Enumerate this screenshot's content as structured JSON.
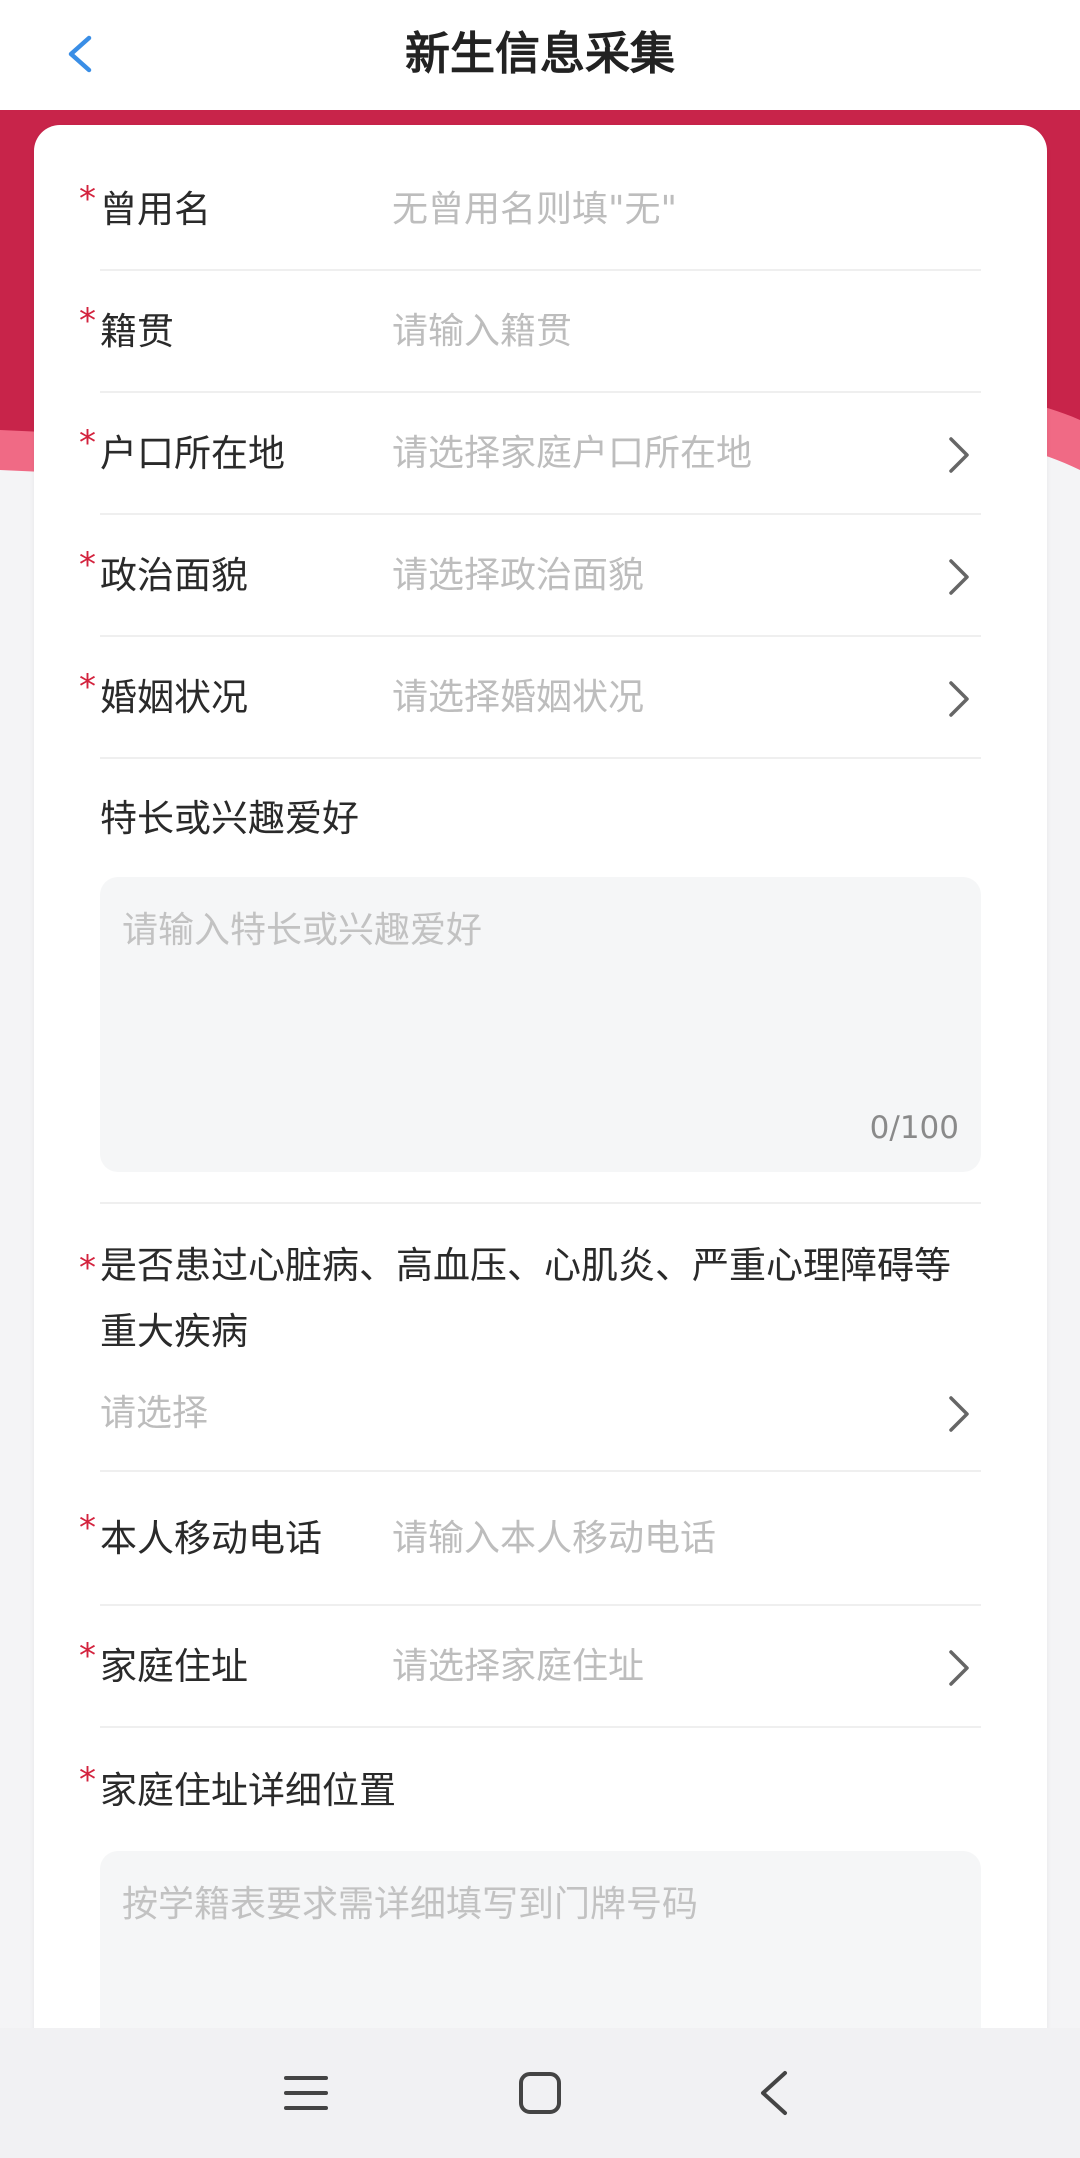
{
  "header": {
    "title": "新生信息采集"
  },
  "form": {
    "former_name": {
      "label": "曾用名",
      "placeholder": "无曾用名则填\"无\""
    },
    "native_place": {
      "label": "籍贯",
      "placeholder": "请输入籍贯"
    },
    "household_location": {
      "label": "户口所在地",
      "placeholder": "请选择家庭户口所在地"
    },
    "political_status": {
      "label": "政治面貌",
      "placeholder": "请选择政治面貌"
    },
    "marital_status": {
      "label": "婚姻状况",
      "placeholder": "请选择婚姻状况"
    },
    "hobbies": {
      "label": "特长或兴趣爱好",
      "placeholder": "请输入特长或兴趣爱好",
      "counter": "0/100"
    },
    "major_illness": {
      "label_line1": "是否患过心脏病、高血压、心肌炎、严重心理障碍等",
      "label_line2": "重大疾病",
      "placeholder": "请选择"
    },
    "mobile_phone": {
      "label": "本人移动电话",
      "placeholder": "请输入本人移动电话"
    },
    "home_address": {
      "label": "家庭住址",
      "placeholder": "请选择家庭住址"
    },
    "address_detail": {
      "label": "家庭住址详细位置",
      "placeholder": "按学籍表要求需详细填写到门牌号码"
    }
  },
  "required_mark": "*",
  "colors": {
    "accent_red": "#c8244a",
    "required_red": "#d3223d",
    "back_blue": "#3a8ee6",
    "placeholder_gray": "#bdbdbd"
  },
  "icons": {
    "back": "chevron-left-icon",
    "row_arrow": "chevron-right-icon",
    "nav_menu": "menu-icon",
    "nav_home": "home-square-icon",
    "nav_back": "back-triangle-icon"
  }
}
